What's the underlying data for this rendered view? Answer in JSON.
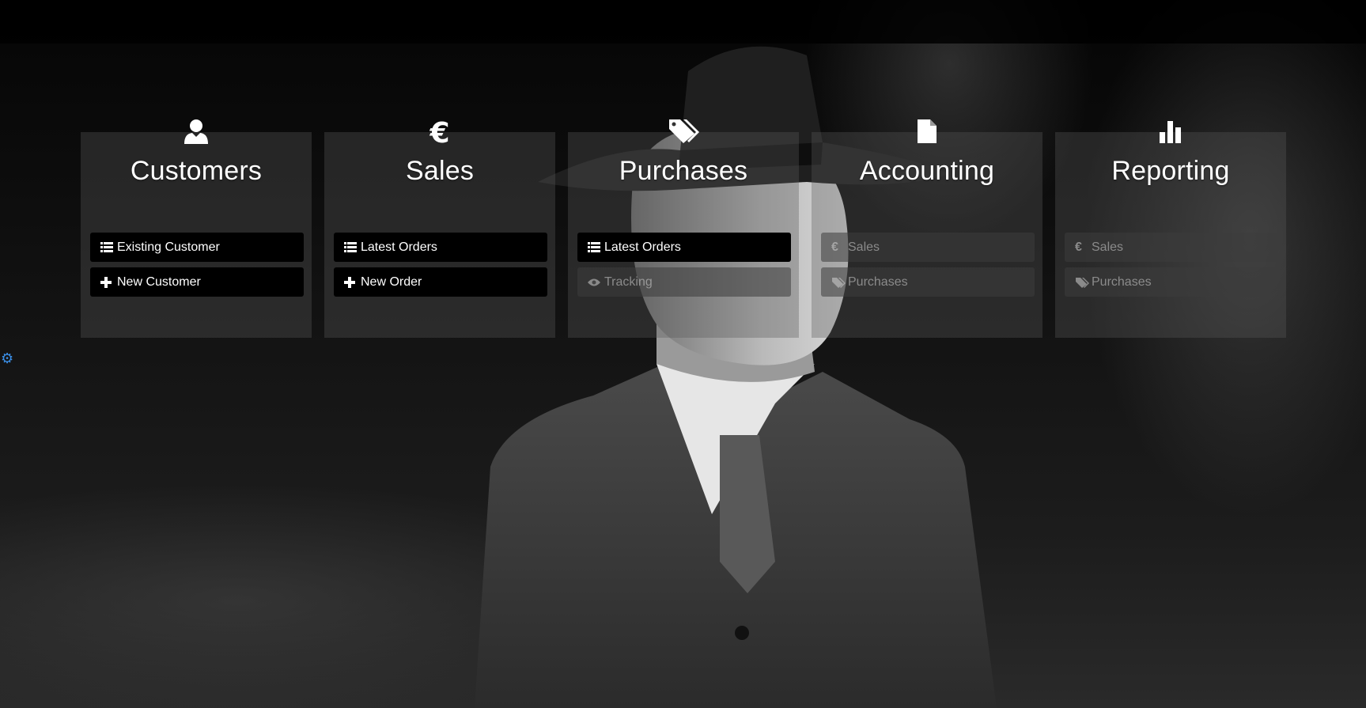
{
  "settings_icon": "gear-icon",
  "panels": [
    {
      "title": "Customers",
      "icon": "user-icon",
      "buttons": [
        {
          "label": "Existing Customer",
          "icon": "list-icon",
          "enabled": true
        },
        {
          "label": "New Customer",
          "icon": "plus-icon",
          "enabled": true
        }
      ]
    },
    {
      "title": "Sales",
      "icon": "euro-icon",
      "buttons": [
        {
          "label": "Latest Orders",
          "icon": "list-icon",
          "enabled": true
        },
        {
          "label": "New Order",
          "icon": "plus-icon",
          "enabled": true
        }
      ]
    },
    {
      "title": "Purchases",
      "icon": "tags-icon",
      "buttons": [
        {
          "label": "Latest Orders",
          "icon": "list-icon",
          "enabled": true
        },
        {
          "label": "Tracking",
          "icon": "eye-icon",
          "enabled": false
        }
      ]
    },
    {
      "title": "Accounting",
      "icon": "file-icon",
      "buttons": [
        {
          "label": "Sales",
          "icon": "euro-icon",
          "enabled": false
        },
        {
          "label": "Purchases",
          "icon": "tags-icon",
          "enabled": false
        }
      ]
    },
    {
      "title": "Reporting",
      "icon": "bar-chart-icon",
      "buttons": [
        {
          "label": "Sales",
          "icon": "euro-icon",
          "enabled": false
        },
        {
          "label": "Purchases",
          "icon": "tags-icon",
          "enabled": false
        }
      ]
    }
  ],
  "colors": {
    "active_button": "#000000",
    "panel_bg": "#5a5a5a",
    "gear": "#3a8ee6"
  }
}
